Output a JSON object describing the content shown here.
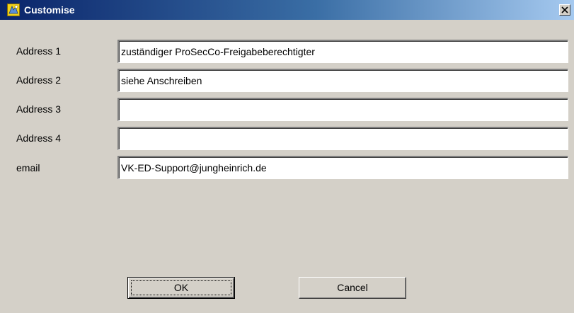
{
  "window": {
    "title": "Customise",
    "icon": "customise-app-icon",
    "close_icon": "close-icon"
  },
  "fields": [
    {
      "label": "Address 1",
      "value": "zuständiger ProSecCo-Freigabeberechtigter"
    },
    {
      "label": "Address 2",
      "value": "siehe Anschreiben"
    },
    {
      "label": "Address 3",
      "value": ""
    },
    {
      "label": "Address 4",
      "value": ""
    },
    {
      "label": "email",
      "value": "VK-ED-Support@jungheinrich.de"
    }
  ],
  "buttons": {
    "ok_label": "OK",
    "cancel_label": "Cancel"
  },
  "colors": {
    "titlebar_start": "#0a246a",
    "titlebar_end": "#a6caf0",
    "face": "#d4d0c8"
  }
}
